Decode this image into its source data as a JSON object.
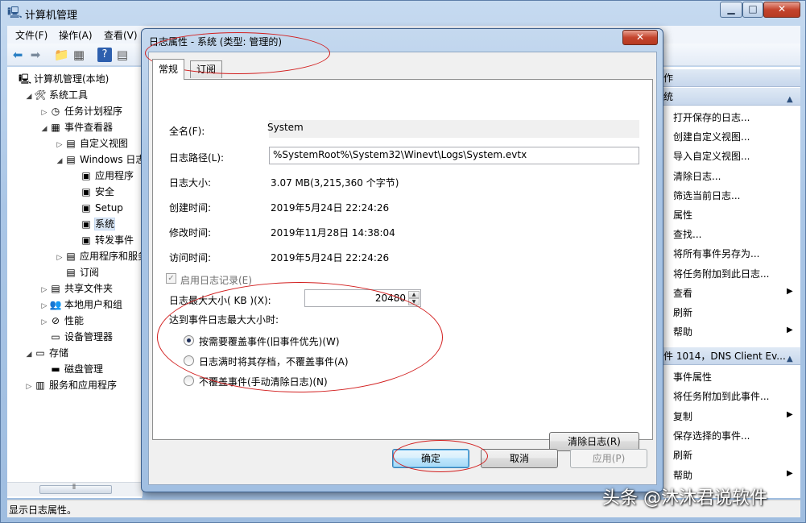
{
  "window": {
    "title": "计算机管理",
    "min": "▁",
    "max": "□",
    "close": "✕"
  },
  "menu": [
    "文件(F)",
    "操作(A)",
    "查看(V)"
  ],
  "toolbar_icons": [
    "back-arrow-icon",
    "forward-arrow-icon",
    "up-folder-icon",
    "show-hide-tree-icon",
    "help-icon",
    "properties-icon"
  ],
  "tree": [
    {
      "label": "计算机管理(本地)",
      "indent": 0,
      "twisty": "",
      "icon": "🖳",
      "icon_name": "computer-icon"
    },
    {
      "label": "系统工具",
      "indent": 1,
      "twisty": "◢",
      "icon": "🛠",
      "icon_name": "tools-icon"
    },
    {
      "label": "任务计划程序",
      "indent": 2,
      "twisty": "▷",
      "icon": "◷",
      "icon_name": "clock-icon"
    },
    {
      "label": "事件查看器",
      "indent": 2,
      "twisty": "◢",
      "icon": "▦",
      "icon_name": "event-viewer-icon"
    },
    {
      "label": "自定义视图",
      "indent": 3,
      "twisty": "▷",
      "icon": "▤",
      "icon_name": "folder-icon"
    },
    {
      "label": "Windows 日志",
      "indent": 3,
      "twisty": "◢",
      "icon": "▤",
      "icon_name": "folder-icon"
    },
    {
      "label": "应用程序",
      "indent": 4,
      "twisty": "",
      "icon": "▣",
      "icon_name": "log-icon"
    },
    {
      "label": "安全",
      "indent": 4,
      "twisty": "",
      "icon": "▣",
      "icon_name": "log-icon"
    },
    {
      "label": "Setup",
      "indent": 4,
      "twisty": "",
      "icon": "▣",
      "icon_name": "log-icon"
    },
    {
      "label": "系统",
      "indent": 4,
      "twisty": "",
      "icon": "▣",
      "icon_name": "log-icon"
    },
    {
      "label": "转发事件",
      "indent": 4,
      "twisty": "",
      "icon": "▣",
      "icon_name": "log-icon"
    },
    {
      "label": "应用程序和服务",
      "indent": 3,
      "twisty": "▷",
      "icon": "▤",
      "icon_name": "folder-icon"
    },
    {
      "label": "订阅",
      "indent": 3,
      "twisty": "",
      "icon": "▤",
      "icon_name": "subscription-icon"
    },
    {
      "label": "共享文件夹",
      "indent": 2,
      "twisty": "▷",
      "icon": "▤",
      "icon_name": "shared-folder-icon"
    },
    {
      "label": "本地用户和组",
      "indent": 2,
      "twisty": "▷",
      "icon": "👥",
      "icon_name": "users-icon"
    },
    {
      "label": "性能",
      "indent": 2,
      "twisty": "▷",
      "icon": "⊘",
      "icon_name": "performance-icon"
    },
    {
      "label": "设备管理器",
      "indent": 2,
      "twisty": "",
      "icon": "▭",
      "icon_name": "device-manager-icon"
    },
    {
      "label": "存储",
      "indent": 1,
      "twisty": "◢",
      "icon": "▭",
      "icon_name": "storage-icon"
    },
    {
      "label": "磁盘管理",
      "indent": 2,
      "twisty": "",
      "icon": "▬",
      "icon_name": "disk-icon"
    },
    {
      "label": "服务和应用程序",
      "indent": 1,
      "twisty": "▷",
      "icon": "▥",
      "icon_name": "services-icon"
    }
  ],
  "tree_scroll": "⦀",
  "actions": {
    "top_header": "作",
    "section1_header": "统",
    "section1_items": [
      "打开保存的日志...",
      "创建自定义视图...",
      "导入自定义视图...",
      "清除日志...",
      "筛选当前日志...",
      "属性",
      "查找...",
      "将所有事件另存为...",
      "将任务附加到此日志...",
      "查看",
      "刷新",
      "帮助"
    ],
    "section2_header": "件 1014，DNS Client Ev...",
    "section2_items": [
      "事件属性",
      "将任务附加到此事件...",
      "复制",
      "保存选择的事件...",
      "刷新",
      "帮助"
    ],
    "arrow": "▶",
    "caret": "▲"
  },
  "status": "显示日志属性。",
  "watermark": "头条 @沐沐君说软件",
  "dialog": {
    "title": "日志属性 - 系统 (类型: 管理的)",
    "close": "✕",
    "tabs": [
      "常规",
      "订阅"
    ],
    "fullname_label": "全名(F):",
    "fullname_value": "System",
    "logpath_label": "日志路径(L):",
    "logpath_value": "%SystemRoot%\\System32\\Winevt\\Logs\\System.evtx",
    "logsize_label": "日志大小:",
    "logsize_value": "3.07 MB(3,215,360 个字节)",
    "created_label": "创建时间:",
    "created_value": "2019年5月24日 22:24:26",
    "modified_label": "修改时间:",
    "modified_value": "2019年11月28日 14:38:04",
    "accessed_label": "访问时间:",
    "accessed_value": "2019年5月24日 22:24:26",
    "enable_logging_label": "启用日志记录(E)",
    "enable_logging_check": "✓",
    "maxsize_label": "日志最大大小( KB )(X):",
    "maxsize_value": "20480",
    "spin_up": "▲",
    "spin_down": "▼",
    "when_max_label": "达到事件日志最大大小时:",
    "radio_options": [
      "按需要覆盖事件(旧事件优先)(W)",
      "日志满时将其存档，不覆盖事件(A)",
      "不覆盖事件(手动清除日志)(N)"
    ],
    "radio_selected": 0,
    "clear_log_button": "清除日志(R)",
    "ok_button": "确定",
    "cancel_button": "取消",
    "apply_button": "应用(P)"
  }
}
